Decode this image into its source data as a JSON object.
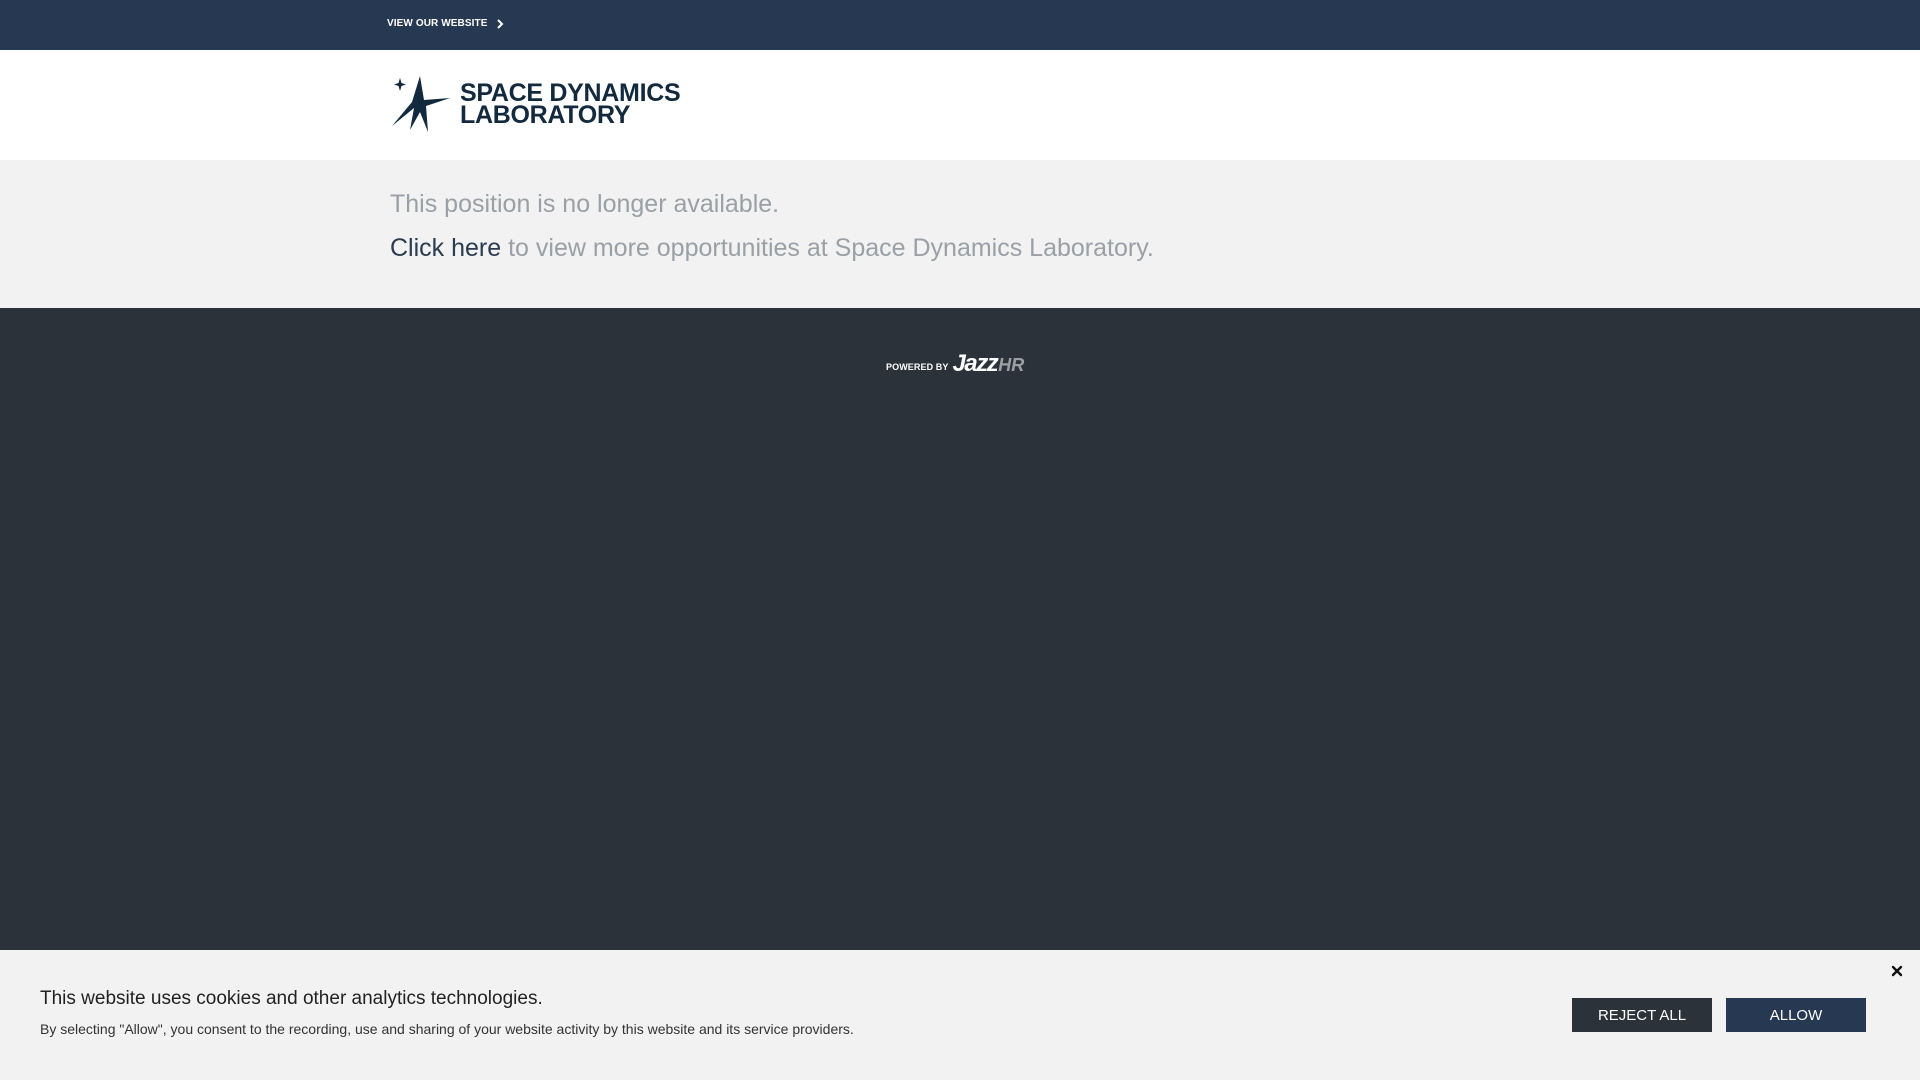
{
  "topbar": {
    "link_label": "VIEW OUR WEBSITE",
    "link_icon": "chevron-right-icon"
  },
  "header": {
    "logo_line1": "SPACE DYNAMICS",
    "logo_line2": "LABORATORY",
    "logo_icon": "star-rocket-logo"
  },
  "message": {
    "line1": "This position is no longer available.",
    "link_text": "Click here",
    "line2_rest": " to view more opportunities at Space Dynamics Laboratory."
  },
  "footer": {
    "powered_by": "POWERED BY",
    "brand_jazz": "Jazz",
    "brand_hr": "HR"
  },
  "cookie": {
    "title": "This website uses cookies and other analytics technologies.",
    "description": "By selecting \"Allow\", you consent to the recording, use and sharing of your website activity by this website and its service providers.",
    "reject_label": "REJECT ALL",
    "allow_label": "ALLOW",
    "close_icon": "close-icon"
  },
  "colors": {
    "topbar": "#263852",
    "page_bg": "#2b323a",
    "band_bg": "#f1f2f1",
    "logo": "#132a3e"
  }
}
